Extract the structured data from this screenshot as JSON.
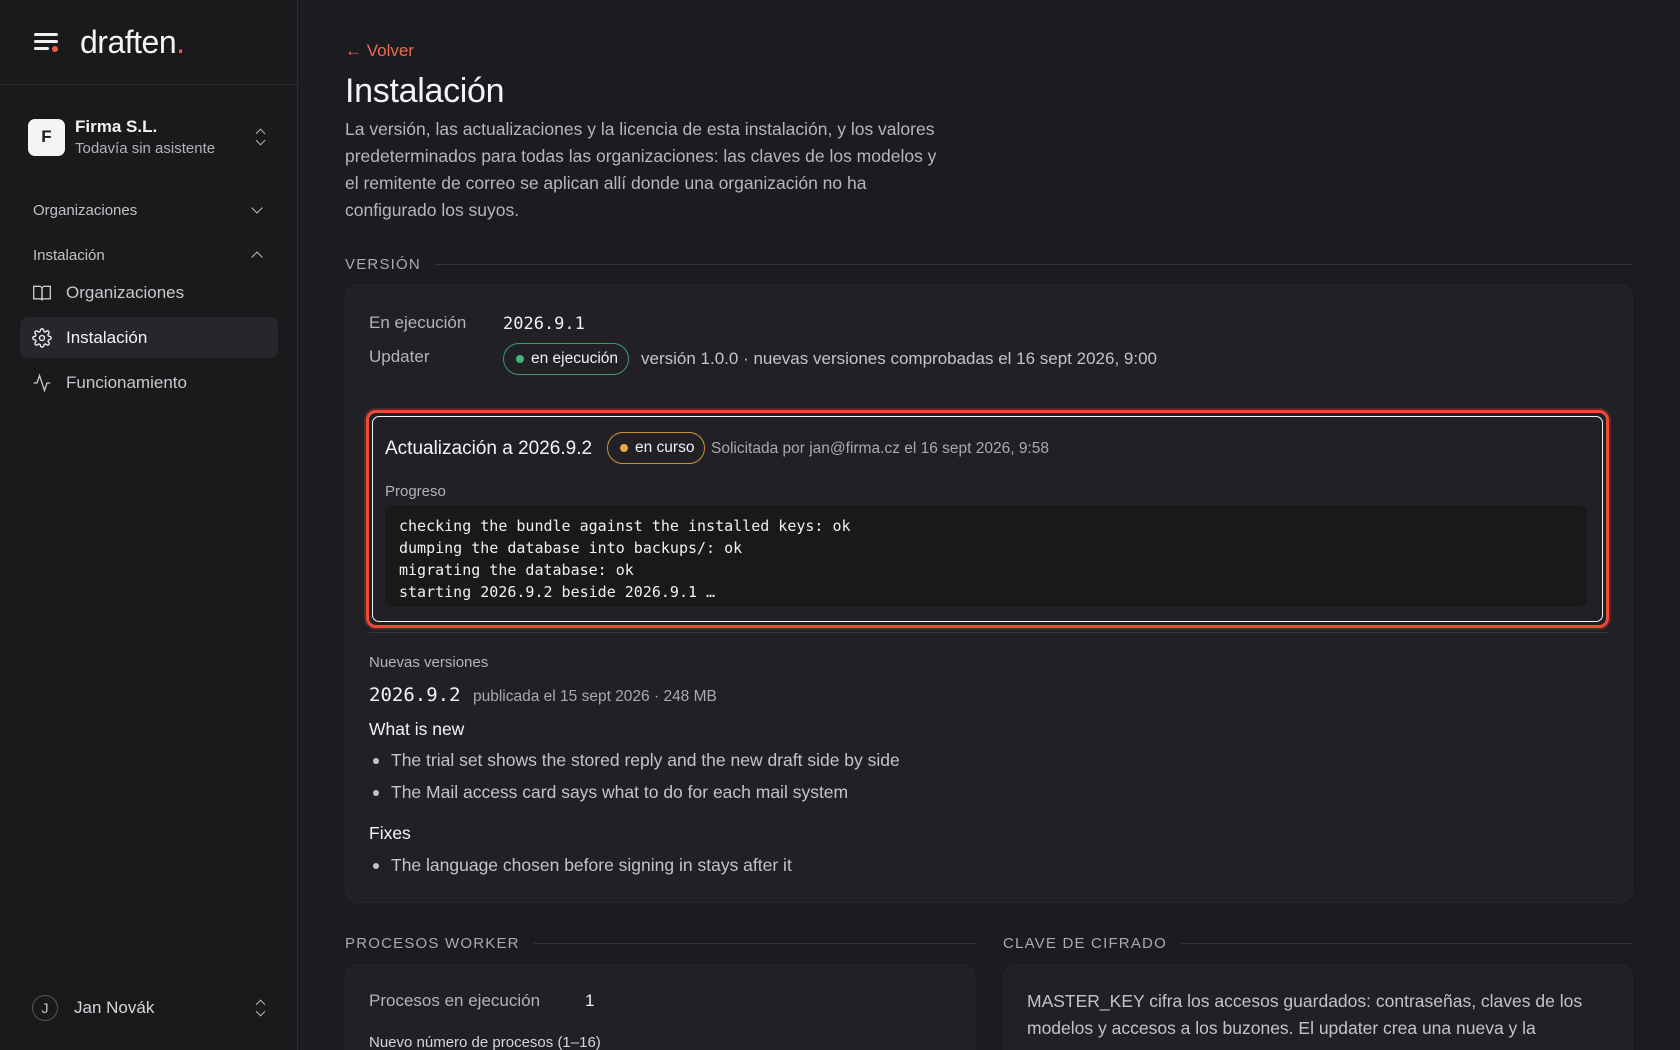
{
  "brand": {
    "name": "draften",
    "dot": "."
  },
  "org": {
    "initial": "F",
    "name": "Firma S.L.",
    "subtitle": "Todavía sin asistente"
  },
  "nav": {
    "group_orgs": "Organizaciones",
    "group_install": "Instalación",
    "items": [
      {
        "label": "Organizaciones",
        "icon": "book-open-icon"
      },
      {
        "label": "Instalación",
        "icon": "gear-icon"
      },
      {
        "label": "Funcionamiento",
        "icon": "activity-icon"
      }
    ]
  },
  "user": {
    "initial": "J",
    "name": "Jan Novák"
  },
  "page": {
    "back": "← Volver",
    "title": "Instalación",
    "description": "La versión, las actualizaciones y la licencia de esta instalación, y los valores predeterminados para todas las organizaciones: las claves de los modelos y el remitente de correo se aplican allí donde una organización no ha configurado los suyos."
  },
  "version": {
    "section": "VERSIÓN",
    "running_label": "En ejecución",
    "running_value": "2026.9.1",
    "updater_label": "Updater",
    "updater_status": "en ejecución",
    "updater_meta": "versión 1.0.0 · nuevas versiones comprobadas el 16 sept 2026, 9:00",
    "update": {
      "title": "Actualización a 2026.9.2",
      "status": "en curso",
      "meta": "Solicitada por jan@firma.cz el 16 sept 2026, 9:58",
      "progress_label": "Progreso",
      "log": [
        "checking the bundle against the installed keys: ok",
        "dumping the database into backups/: ok",
        "migrating the database: ok",
        "starting 2026.9.2 beside 2026.9.1 …"
      ]
    },
    "new_versions_label": "Nuevas versiones",
    "new_version": "2026.9.2",
    "new_version_meta": "publicada el 15 sept 2026 · 248 MB",
    "whats_new_title": "What is new",
    "whats_new": [
      "The trial set shows the stored reply and the new draft side by side",
      "The Mail access card says what to do for each mail system"
    ],
    "fixes_title": "Fixes",
    "fixes": [
      "The language chosen before signing in stays after it"
    ]
  },
  "workers": {
    "section": "PROCESOS WORKER",
    "running_label": "Procesos en ejecución",
    "running_value": "1",
    "new_count_label": "Nuevo número de procesos (1–16)"
  },
  "encryption": {
    "section": "CLAVE DE CIFRADO",
    "text": "MASTER_KEY cifra los accesos guardados: contraseñas, claves de los modelos y accesos a los buzones. El updater crea una nueva y la"
  },
  "colors": {
    "accent": "#ee6a52",
    "highlight": "#ef4a36",
    "ok": "#44b47c",
    "pending": "#e2a94a"
  }
}
